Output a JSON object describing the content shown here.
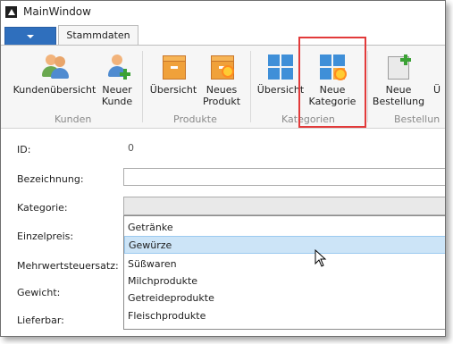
{
  "window": {
    "title": "MainWindow"
  },
  "ribbon": {
    "tab": "Stammdaten",
    "groups": {
      "kunden": {
        "label": "Kunden",
        "overview": "Kundenübersicht",
        "new_line1": "Neuer",
        "new_line2": "Kunde"
      },
      "produkte": {
        "label": "Produkte",
        "overview": "Übersicht",
        "new_line1": "Neues",
        "new_line2": "Produkt"
      },
      "kategorien": {
        "label": "Kategorien",
        "overview": "Übersicht",
        "new_line1": "Neue",
        "new_line2": "Kategorie"
      },
      "bestellungen": {
        "label": "Bestellun",
        "new_line1": "Neue",
        "new_line2": "Bestellung",
        "partial": "Ü"
      }
    }
  },
  "form": {
    "id_label": "ID:",
    "id_value": "0",
    "bezeichnung_label": "Bezeichnung:",
    "bezeichnung_value": "",
    "kategorie_label": "Kategorie:",
    "einzelpreis_label": "Einzelpreis:",
    "mwst_label": "Mehrwertsteuersatz:",
    "gewicht_label": "Gewicht:",
    "lieferbar_label": "Lieferbar:"
  },
  "kategorie_dropdown": {
    "options": [
      "Getränke",
      "Gewürze",
      "Süßwaren",
      "Milchprodukte",
      "Getreideprodukte",
      "Fleischprodukte"
    ],
    "selected": "Gewürze"
  },
  "colors": {
    "accent": "#2f6fbd",
    "selection": "#cce4f7",
    "highlight_box": "#e23a3a"
  }
}
